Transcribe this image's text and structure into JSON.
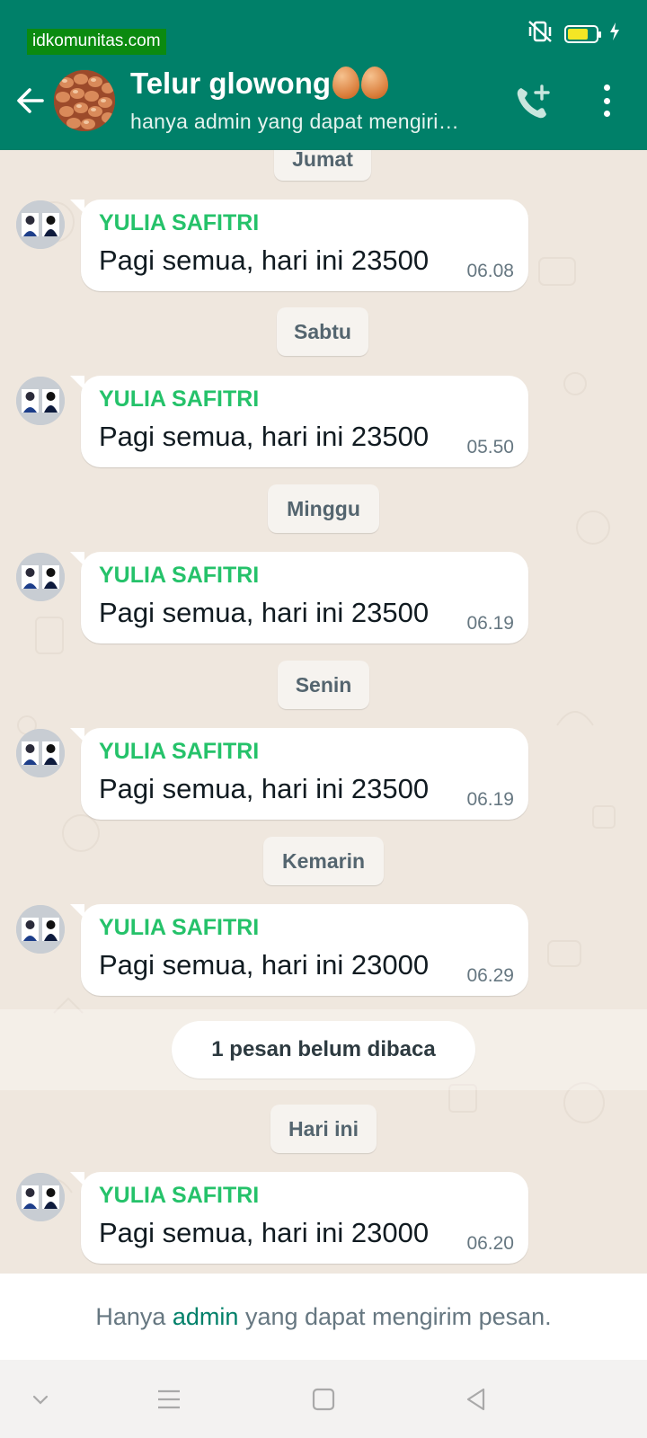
{
  "watermark": "idkomunitas.com",
  "header": {
    "title": "Telur glowong",
    "title_emoji": "egg-emoji",
    "subtitle": "hanya admin yang dapat mengiri…",
    "colors": {
      "bar": "#008069",
      "accent_green": "#25c26a"
    }
  },
  "chat": {
    "days": [
      {
        "label": "Jumat",
        "sender": "YULIA SAFITRI",
        "text": "Pagi semua, hari ini 23500",
        "time": "06.08"
      },
      {
        "label": "Sabtu",
        "sender": "YULIA SAFITRI",
        "text": "Pagi semua, hari ini 23500",
        "time": "05.50"
      },
      {
        "label": "Minggu",
        "sender": "YULIA SAFITRI",
        "text": "Pagi semua, hari ini 23500",
        "time": "06.19"
      },
      {
        "label": "Senin",
        "sender": "YULIA SAFITRI",
        "text": "Pagi semua, hari ini 23500",
        "time": "06.19"
      },
      {
        "label": "Kemarin",
        "sender": "YULIA SAFITRI",
        "text": "Pagi semua, hari ini 23000",
        "time": "06.29"
      },
      {
        "label": "Hari ini",
        "sender": "YULIA SAFITRI",
        "text": "Pagi semua, hari ini 23000",
        "time": "06.20"
      }
    ],
    "unread_label": "1 pesan belum dibaca"
  },
  "footer": {
    "before": "Hanya ",
    "link": "admin",
    "after": " yang dapat mengirim pesan."
  }
}
